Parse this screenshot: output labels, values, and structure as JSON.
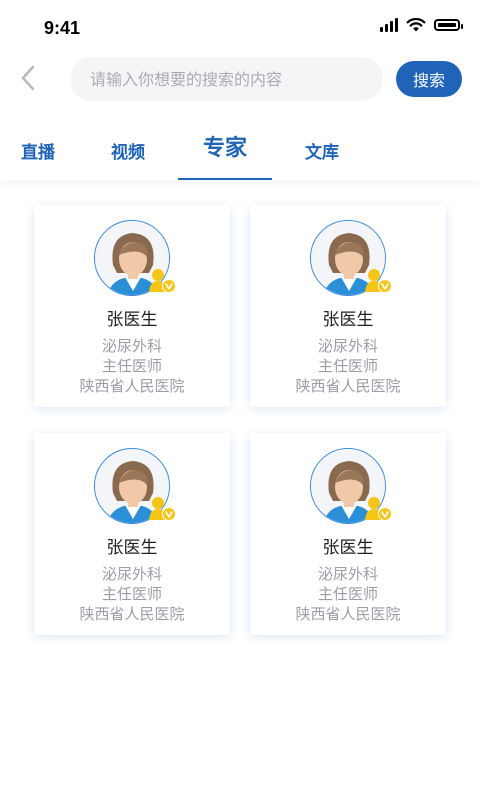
{
  "status_bar": {
    "time": "9:41"
  },
  "search": {
    "placeholder": "请输入你想要的搜索的内容",
    "button_label": "搜索"
  },
  "tabs": [
    {
      "label": "直播"
    },
    {
      "label": "视频"
    },
    {
      "label": "专家"
    },
    {
      "label": "文库"
    }
  ],
  "active_tab": "专家",
  "experts": [
    {
      "name": "张医生",
      "department": "泌尿外科",
      "title": "主任医师",
      "hospital": "陕西省人民医院"
    },
    {
      "name": "张医生",
      "department": "泌尿外科",
      "title": "主任医师",
      "hospital": "陕西省人民医院"
    },
    {
      "name": "张医生",
      "department": "泌尿外科",
      "title": "主任医师",
      "hospital": "陕西省人民医院"
    },
    {
      "name": "张医生",
      "department": "泌尿外科",
      "title": "主任医师",
      "hospital": "陕西省人民医院"
    }
  ],
  "colors": {
    "accent": "#1f64b8",
    "badge": "#f5c518",
    "muted_text": "#9a9ea5"
  },
  "icons": {
    "back": "chevron-left-icon",
    "verified": "verified-badge-icon",
    "wifi": "wifi-icon",
    "battery": "battery-icon",
    "signal": "signal-icon"
  }
}
